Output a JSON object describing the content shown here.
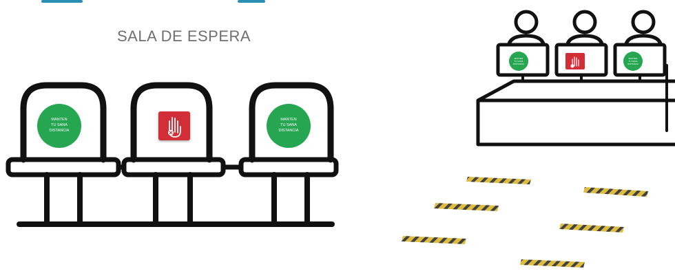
{
  "waiting_room": {
    "title": "SALA DE ESPERA",
    "chairs": [
      {
        "sign": "green",
        "text": [
          "MANTEN",
          "TU SANA",
          "DISTANCIA"
        ]
      },
      {
        "sign": "red",
        "text": []
      },
      {
        "sign": "green",
        "text": [
          "MANTEN",
          "TU SANA",
          "DISTANCIA"
        ]
      }
    ]
  },
  "reception": {
    "monitors": [
      {
        "sign": "green",
        "text": [
          "MANTEN",
          "TU SANA",
          "DISTANCIA"
        ]
      },
      {
        "sign": "red",
        "text": []
      },
      {
        "sign": "green",
        "text": [
          "MANTEN",
          "TU SANA",
          "DISTANCIA"
        ]
      }
    ]
  },
  "colors": {
    "green": "#27a652",
    "red": "#d12e37",
    "outline": "#111111",
    "tape_yellow": "#d9b52a",
    "tape_black": "#2b2b2b",
    "title_text": "#6f6f6f",
    "top_line": "#2a8fb3"
  }
}
